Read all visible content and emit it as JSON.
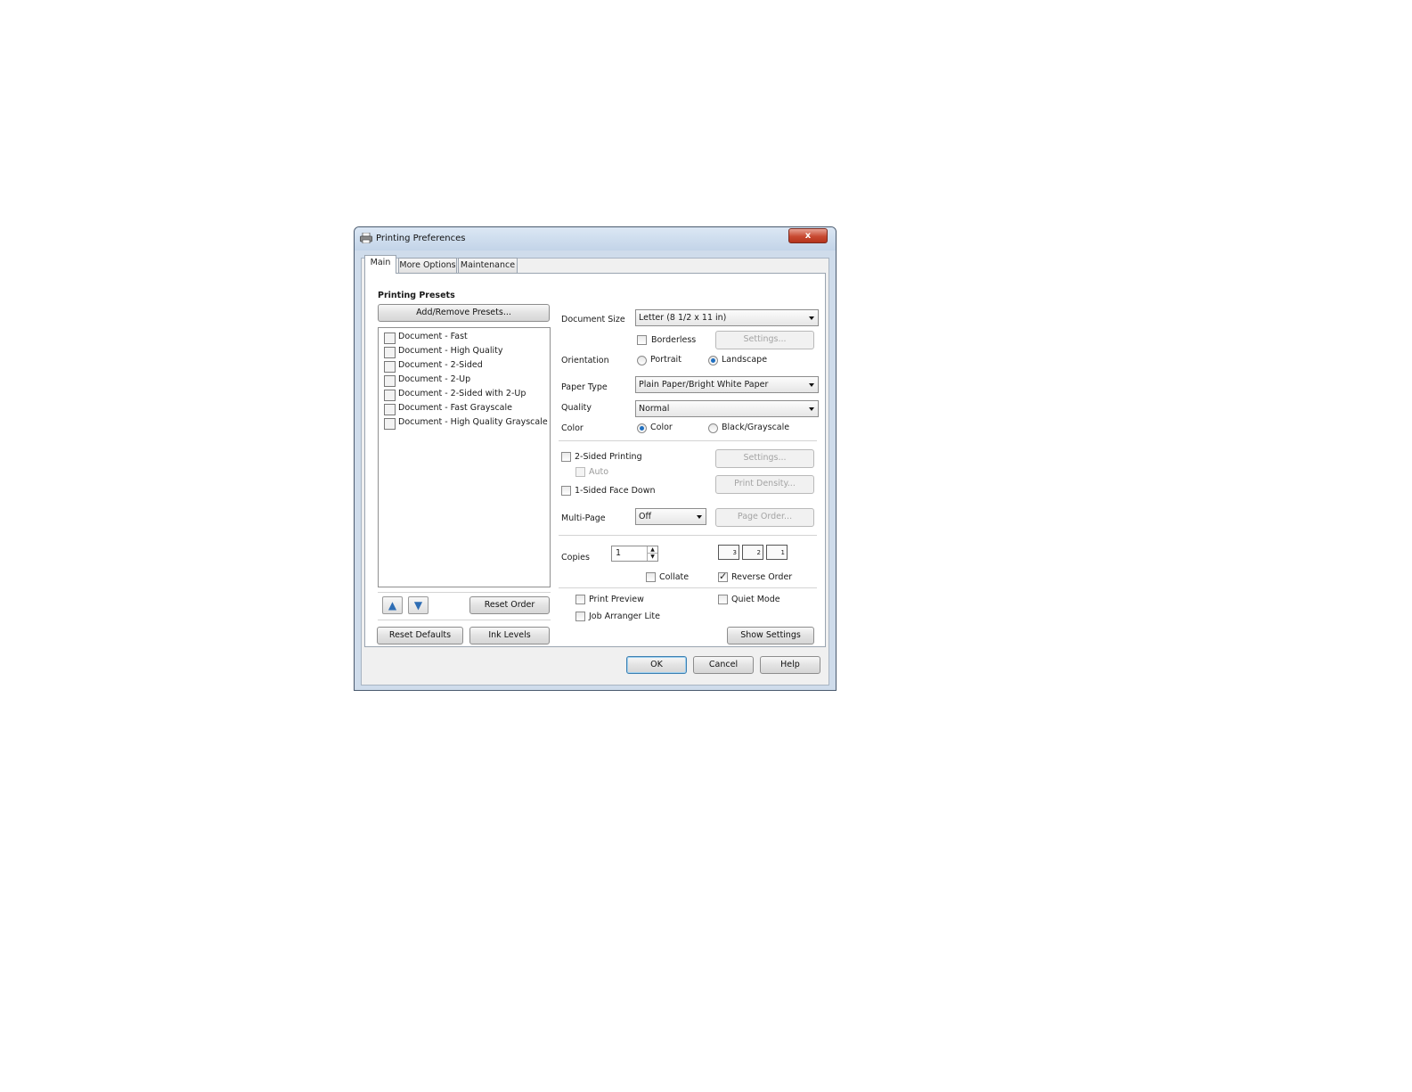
{
  "window": {
    "title": "Printing Preferences",
    "close_glyph": "x"
  },
  "tabs": [
    {
      "label": "Main",
      "active": true
    },
    {
      "label": "More Options",
      "active": false
    },
    {
      "label": "Maintenance",
      "active": false
    }
  ],
  "presets": {
    "heading": "Printing Presets",
    "add_remove_label": "Add/Remove Presets...",
    "items": [
      "Document - Fast",
      "Document - High Quality",
      "Document - 2-Sided",
      "Document - 2-Up",
      "Document - 2-Sided with 2-Up",
      "Document - Fast Grayscale",
      "Document - High Quality Grayscale"
    ],
    "move_up_glyph": "▲",
    "move_down_glyph": "▼",
    "reset_order_label": "Reset Order",
    "reset_defaults_label": "Reset Defaults",
    "ink_levels_label": "Ink Levels"
  },
  "settings": {
    "document_size": {
      "label": "Document Size",
      "value": "Letter (8 1/2 x 11 in)"
    },
    "borderless": {
      "label": "Borderless",
      "checked": false
    },
    "borderless_settings_label": "Settings...",
    "orientation": {
      "label": "Orientation",
      "portrait": "Portrait",
      "landscape": "Landscape",
      "selected": "landscape"
    },
    "paper_type": {
      "label": "Paper Type",
      "value": "Plain Paper/Bright White Paper"
    },
    "quality": {
      "label": "Quality",
      "value": "Normal"
    },
    "color": {
      "label": "Color",
      "color_option": "Color",
      "bw_option": "Black/Grayscale",
      "selected": "color"
    },
    "two_sided": {
      "label": "2-Sided Printing",
      "checked": false
    },
    "two_sided_settings_label": "Settings...",
    "auto": {
      "label": "Auto",
      "checked": false
    },
    "one_sided_face_down": {
      "label": "1-Sided Face Down",
      "checked": false
    },
    "print_density_label": "Print Density...",
    "multi_page": {
      "label": "Multi-Page",
      "value": "Off"
    },
    "page_order_label": "Page Order...",
    "copies": {
      "label": "Copies",
      "value": "1"
    },
    "collate": {
      "label": "Collate",
      "checked": false
    },
    "reverse_order": {
      "label": "Reverse Order",
      "checked": true
    },
    "print_preview": {
      "label": "Print Preview",
      "checked": false
    },
    "quiet_mode": {
      "label": "Quiet Mode",
      "checked": false
    },
    "job_arranger": {
      "label": "Job Arranger Lite",
      "checked": false
    },
    "show_settings_label": "Show Settings"
  },
  "dialog_buttons": {
    "ok": "OK",
    "cancel": "Cancel",
    "help": "Help"
  },
  "colors": {
    "accent": "#1f6fc0",
    "close_button": "#c84a32",
    "frame": "#cfdceb"
  }
}
